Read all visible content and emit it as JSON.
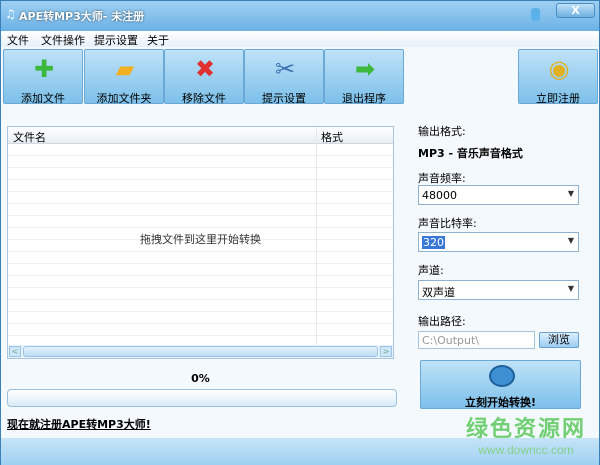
{
  "window": {
    "title": "APE转MP3大师- 未注册",
    "close_label": "X"
  },
  "menu": [
    "文件",
    "文件操作",
    "提示设置",
    "关于"
  ],
  "toolbar": [
    {
      "label": "添加文件",
      "icon": "plus-icon",
      "glyph": "✚",
      "color": "#3cb83c"
    },
    {
      "label": "添加文件夹",
      "icon": "folder-icon",
      "glyph": "▰",
      "color": "#f0b020"
    },
    {
      "label": "移除文件",
      "icon": "remove-x-icon",
      "glyph": "✖",
      "color": "#e03030"
    },
    {
      "label": "提示设置",
      "icon": "tools-icon",
      "glyph": "✂",
      "color": "#3a6fb0"
    },
    {
      "label": "退出程序",
      "icon": "exit-arrow-icon",
      "glyph": "➡",
      "color": "#3cb83c"
    }
  ],
  "register_button": {
    "label": "立即注册",
    "glyph": "◉",
    "color": "#e0b020"
  },
  "file_list": {
    "columns": [
      "文件名",
      "格式"
    ],
    "empty_hint": "拖拽文件到这里开始转换"
  },
  "progress": {
    "text": "0%",
    "value": 0
  },
  "register_link": "现在就注册APE转MP3大师!",
  "settings": {
    "format_label": "输出格式:",
    "format_value": "MP3 - 音乐声音格式",
    "samplerate_label": "声音频率:",
    "samplerate_value": "48000",
    "bitrate_label": "声音比特率:",
    "bitrate_value": "320",
    "channel_label": "声道:",
    "channel_value": "双声道",
    "output_label": "输出路径:",
    "output_value": "C:\\Output\\",
    "browse_label": "浏览",
    "start_label": "立刻开始转换!"
  },
  "watermark": {
    "name": "绿色资源网",
    "url": "www.downcc.com"
  }
}
